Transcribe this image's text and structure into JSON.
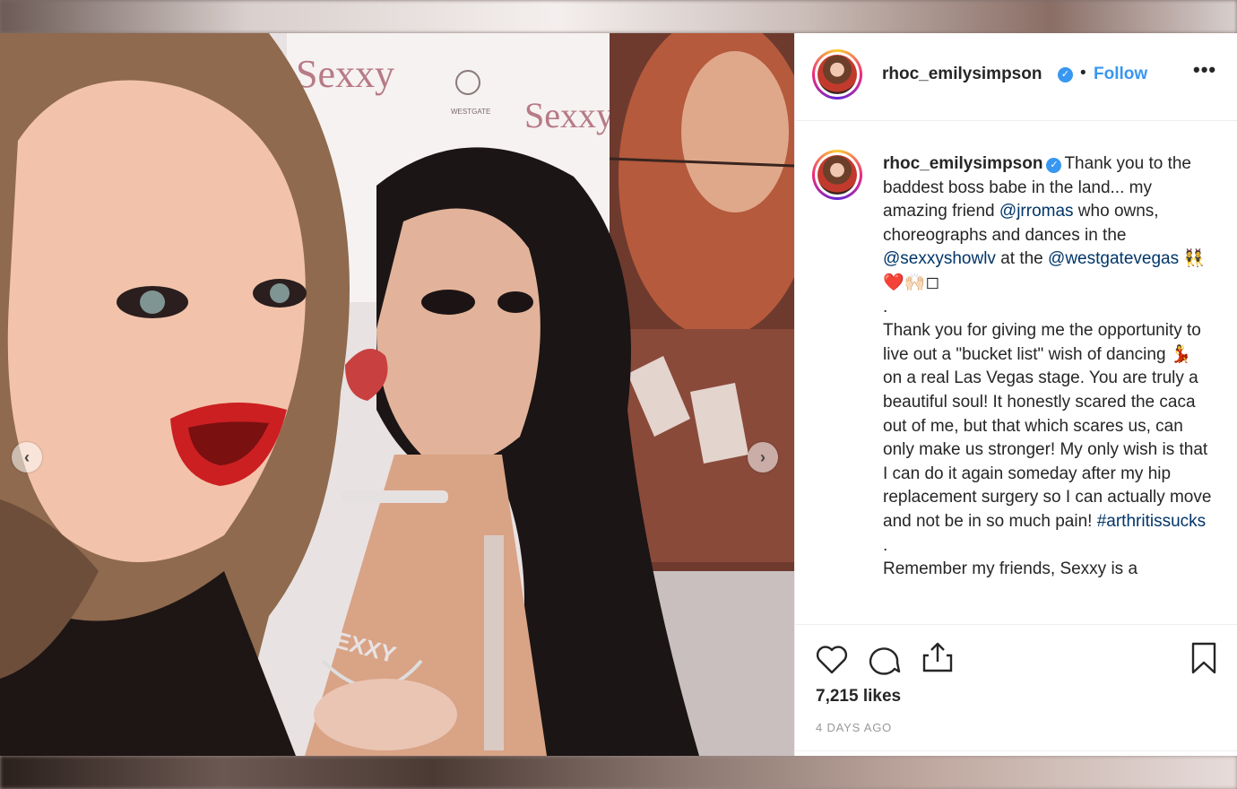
{
  "post": {
    "username": "rhoc_emilysimpson",
    "verified_mark": "✓",
    "separator": "•",
    "follow_label": "Follow",
    "more_label": "•••"
  },
  "caption": {
    "username": "rhoc_emilysimpson",
    "line1": "Thank you to the baddest boss babe in the land... my amazing friend ",
    "mention1": "@jrromas",
    "line2": " who owns, choreographs and dances in the ",
    "mention2": "@sexxyshowlv",
    "line3": " at the ",
    "mention3": "@westgatevegas",
    "emoji1": " 👯❤️🙌🏻◻",
    "dot1": ".",
    "para2": "Thank you for giving me the opportunity to live out a \"bucket list\" wish of dancing 💃 on a real Las Vegas stage. You are truly a beautiful soul! It honestly scared the caca out of me, but that which scares us, can only make us stronger! My only wish is that I can do it again someday after my hip replacement surgery so I can actually move and not be in so much pain! ",
    "hashtag": "#arthritissucks",
    "dot2": ".",
    "para3": "Remember my friends, Sexxy is a"
  },
  "stats": {
    "likes": "7,215 likes",
    "time": "4 DAYS AGO"
  },
  "carousel": {
    "prev_label": "‹",
    "next_label": "›"
  },
  "photo": {
    "backdrop_brand_1": "Sexxy",
    "backdrop_brand_2": "Sexxy",
    "venue_logo": "WESTGATE",
    "necklace_text": "SEXXY"
  },
  "icons": {
    "like": "heart-icon",
    "comment": "comment-icon",
    "share": "share-icon",
    "save": "bookmark-icon"
  },
  "colors": {
    "accent": "#3897f0",
    "link": "#003569",
    "text": "#262626",
    "muted": "#999999"
  }
}
